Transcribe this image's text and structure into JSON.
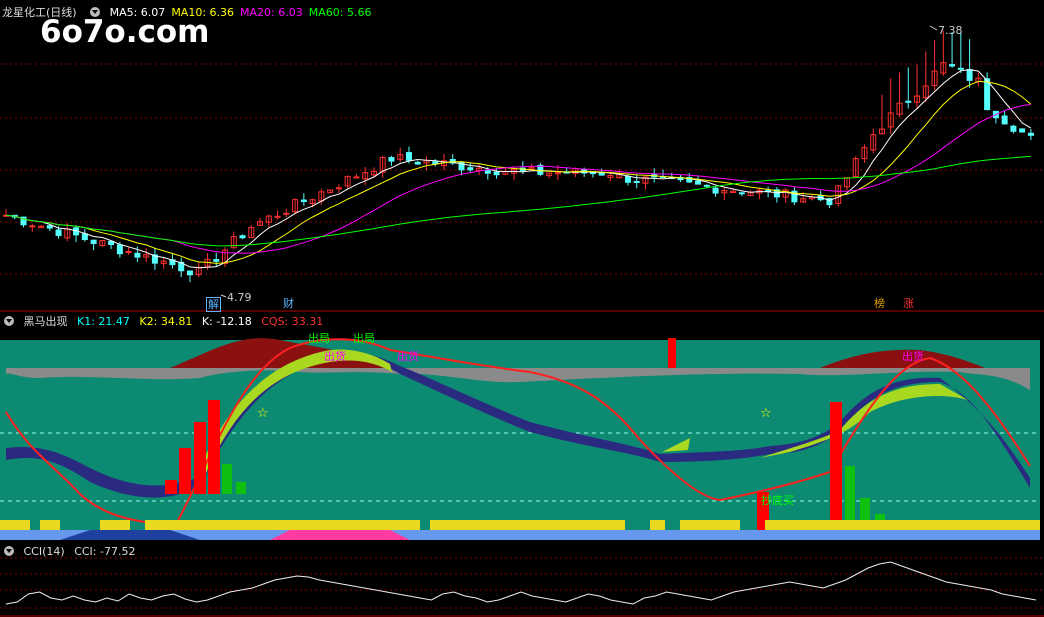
{
  "watermark": "6o7o.com",
  "main_panel": {
    "title": "龙星化工(日线)",
    "ma_labels": [
      {
        "text": "MA5: 6.07",
        "color": "#ffffff"
      },
      {
        "text": "MA10: 6.36",
        "color": "#ffff00"
      },
      {
        "text": "MA20: 6.03",
        "color": "#ff00ff"
      },
      {
        "text": "MA60: 5.66",
        "color": "#00ff00"
      }
    ],
    "high_label": "7.38",
    "low_label": "4.79",
    "badges": [
      {
        "text": "解",
        "color": "#5fb4ff"
      },
      {
        "text": "财",
        "color": "#5fb4ff"
      },
      {
        "text": "榜",
        "color": "#e0a000"
      },
      {
        "text": "涨",
        "color": "#ff3030"
      }
    ]
  },
  "indicator_panel": {
    "title": "黑马出现",
    "values": [
      {
        "text": "K1: 21.47",
        "color": "#00ffff"
      },
      {
        "text": "K2: 34.81",
        "color": "#ffff00"
      },
      {
        "text": "K: -12.18",
        "color": "#ffffff"
      },
      {
        "text": "CQS: 33.31",
        "color": "#ff3030"
      }
    ],
    "signals": [
      {
        "text": "出局",
        "color": "#00ff00"
      },
      {
        "text": "出局",
        "color": "#00ff00"
      },
      {
        "text": "出货",
        "color": "#ff00ff"
      },
      {
        "text": "出货",
        "color": "#ff00ff"
      },
      {
        "text": "出货",
        "color": "#ff00ff"
      },
      {
        "text": "抄底买",
        "color": "#00ff00"
      }
    ],
    "star_glyph": "☆"
  },
  "cci_panel": {
    "title": "CCI(14)",
    "value": "CCI: -77.52"
  },
  "colors": {
    "up": "#ff3030",
    "down": "#54ffff",
    "ma5": "#ffffff",
    "ma10": "#ffff00",
    "ma20": "#ff00ff",
    "ma60": "#00ff00",
    "grid": "#8b0000",
    "indicator_bg": "#0d8a72"
  }
}
